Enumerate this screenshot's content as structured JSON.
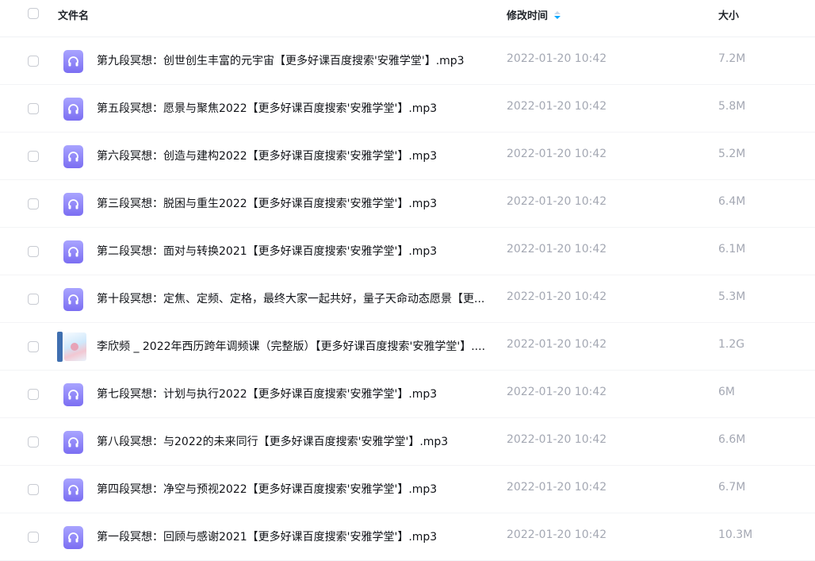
{
  "header": {
    "name_label": "文件名",
    "time_label": "修改时间",
    "size_label": "大小"
  },
  "files": [
    {
      "name": "第九段冥想：创世创生丰富的元宇宙【更多好课百度搜索'安雅学堂'】.mp3",
      "time": "2022-01-20 10:42",
      "size": "7.2M",
      "icon": "audio-file-icon"
    },
    {
      "name": "第五段冥想：愿景与聚焦2022【更多好课百度搜索'安雅学堂'】.mp3",
      "time": "2022-01-20 10:42",
      "size": "5.8M",
      "icon": "audio-file-icon"
    },
    {
      "name": "第六段冥想：创造与建构2022【更多好课百度搜索'安雅学堂'】.mp3",
      "time": "2022-01-20 10:42",
      "size": "5.2M",
      "icon": "audio-file-icon"
    },
    {
      "name": "第三段冥想：脱困与重生2022【更多好课百度搜索'安雅学堂'】.mp3",
      "time": "2022-01-20 10:42",
      "size": "6.4M",
      "icon": "audio-file-icon"
    },
    {
      "name": "第二段冥想：面对与转换2021【更多好课百度搜索'安雅学堂'】.mp3",
      "time": "2022-01-20 10:42",
      "size": "6.1M",
      "icon": "audio-file-icon"
    },
    {
      "name": "第十段冥想：定焦、定频、定格，最终大家一起共好，量子天命动态愿景【更...",
      "time": "2022-01-20 10:42",
      "size": "5.3M",
      "icon": "audio-file-icon"
    },
    {
      "name": "李欣频 _ 2022年西历跨年调频课（完整版）【更多好课百度搜索'安雅学堂'】....",
      "time": "2022-01-20 10:42",
      "size": "1.2G",
      "icon": "video-thumbnail-icon"
    },
    {
      "name": "第七段冥想：计划与执行2022【更多好课百度搜索'安雅学堂'】.mp3",
      "time": "2022-01-20 10:42",
      "size": "6M",
      "icon": "audio-file-icon"
    },
    {
      "name": "第八段冥想：与2022的未来同行【更多好课百度搜索'安雅学堂'】.mp3",
      "time": "2022-01-20 10:42",
      "size": "6.6M",
      "icon": "audio-file-icon"
    },
    {
      "name": "第四段冥想：净空与预视2022【更多好课百度搜索'安雅学堂'】.mp3",
      "time": "2022-01-20 10:42",
      "size": "6.7M",
      "icon": "audio-file-icon"
    },
    {
      "name": "第一段冥想：回顾与感谢2021【更多好课百度搜索'安雅学堂'】.mp3",
      "time": "2022-01-20 10:42",
      "size": "10.3M",
      "icon": "audio-file-icon"
    }
  ]
}
